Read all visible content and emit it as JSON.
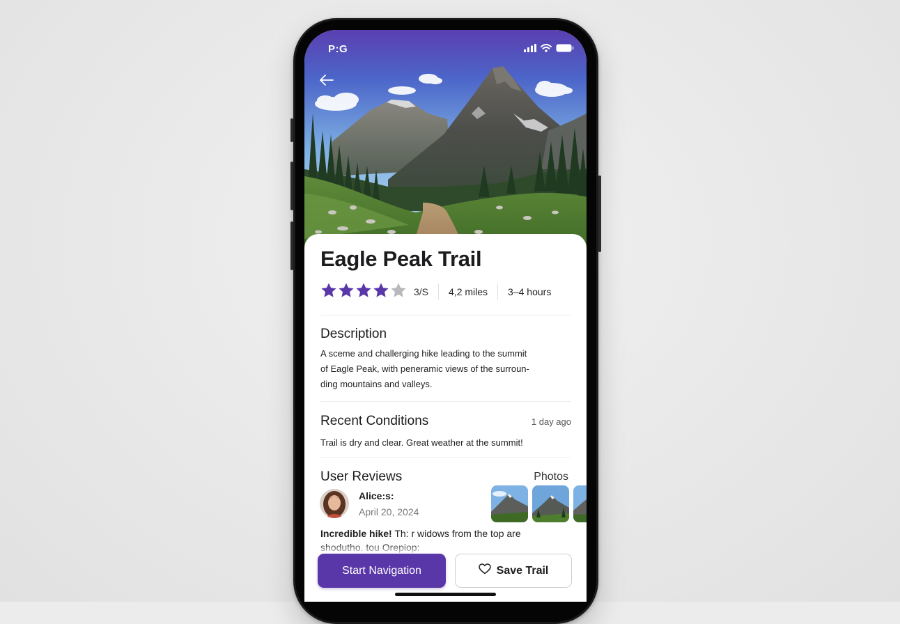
{
  "status_bar": {
    "time": "P:G"
  },
  "trail": {
    "title": "Eagle Peak Trail",
    "rating_value": 4,
    "rating_max": 5,
    "rating_text": "3/S",
    "distance": "4,2 miles",
    "duration": "3–4 hours"
  },
  "description": {
    "heading": "Description",
    "lines": [
      "A sceme and challerging hike leading to the summit",
      "of Eagle Peak, with peneramic views of the surroun-",
      "ding mountains and valleys."
    ]
  },
  "conditions": {
    "heading": "Recent Conditions",
    "time_ago": "1 day ago",
    "text": "Trail is dry and clear. Great weather at the summit!"
  },
  "reviews": {
    "heading": "User Reviews",
    "photos_label": "Photos",
    "reviewer_name": "Alice:s:",
    "review_date": "April 20, 2024",
    "review_bold": "Incredible hike!",
    "review_text": " Th: r widows from the top are",
    "review_text_2": "shodutho. tou Orepiop:"
  },
  "actions": {
    "start_label": "Start Navigation",
    "save_label": "Save Trail"
  },
  "colors": {
    "accent": "#5a37a8",
    "star_filled": "#5a37a8",
    "star_empty": "#b9b9bd"
  },
  "icons": {
    "back": "arrow-left-icon",
    "save": "heart-outline-icon",
    "signal": "signal-icon",
    "wifi": "wifi-icon",
    "battery": "battery-icon"
  }
}
